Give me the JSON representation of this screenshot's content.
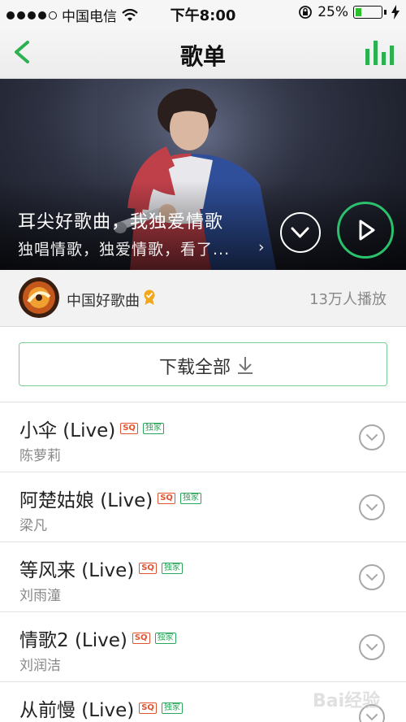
{
  "status_bar": {
    "carrier": "中国电信",
    "time": "下午8:00",
    "battery_percent": "25%",
    "battery_level": 0.25,
    "signal_bars": 4
  },
  "nav": {
    "title": "歌单",
    "back_icon": "chevron-left-icon",
    "right_icon": "equalizer-icon",
    "accent_color": "#2bb14f"
  },
  "hero": {
    "title": "耳尖好歌曲，我独爱情歌",
    "subtitle": "独唱情歌，独爱情歌，看了...",
    "subtitle_arrow": "›",
    "download_icon": "chevron-down-circle-icon",
    "play_icon": "play-icon"
  },
  "owner": {
    "name": "中国好歌曲",
    "plays": "13万人播放"
  },
  "download_all": {
    "label": "下载全部"
  },
  "songs": [
    {
      "title": "小伞 (Live)",
      "artist": "陈萝莉",
      "tag_quality": "SQ",
      "tag_exclusive": "独家"
    },
    {
      "title": "阿楚姑娘 (Live)",
      "artist": "梁凡",
      "tag_quality": "SQ",
      "tag_exclusive": "独家"
    },
    {
      "title": "等风来 (Live)",
      "artist": "刘雨潼",
      "tag_quality": "SQ",
      "tag_exclusive": "独家"
    },
    {
      "title": "情歌2 (Live)",
      "artist": "刘润洁",
      "tag_quality": "SQ",
      "tag_exclusive": "独家"
    },
    {
      "title": "从前慢 (Live)",
      "artist": "",
      "tag_quality": "SQ",
      "tag_exclusive": "独家"
    }
  ],
  "watermark": {
    "text": "Bai经验"
  }
}
